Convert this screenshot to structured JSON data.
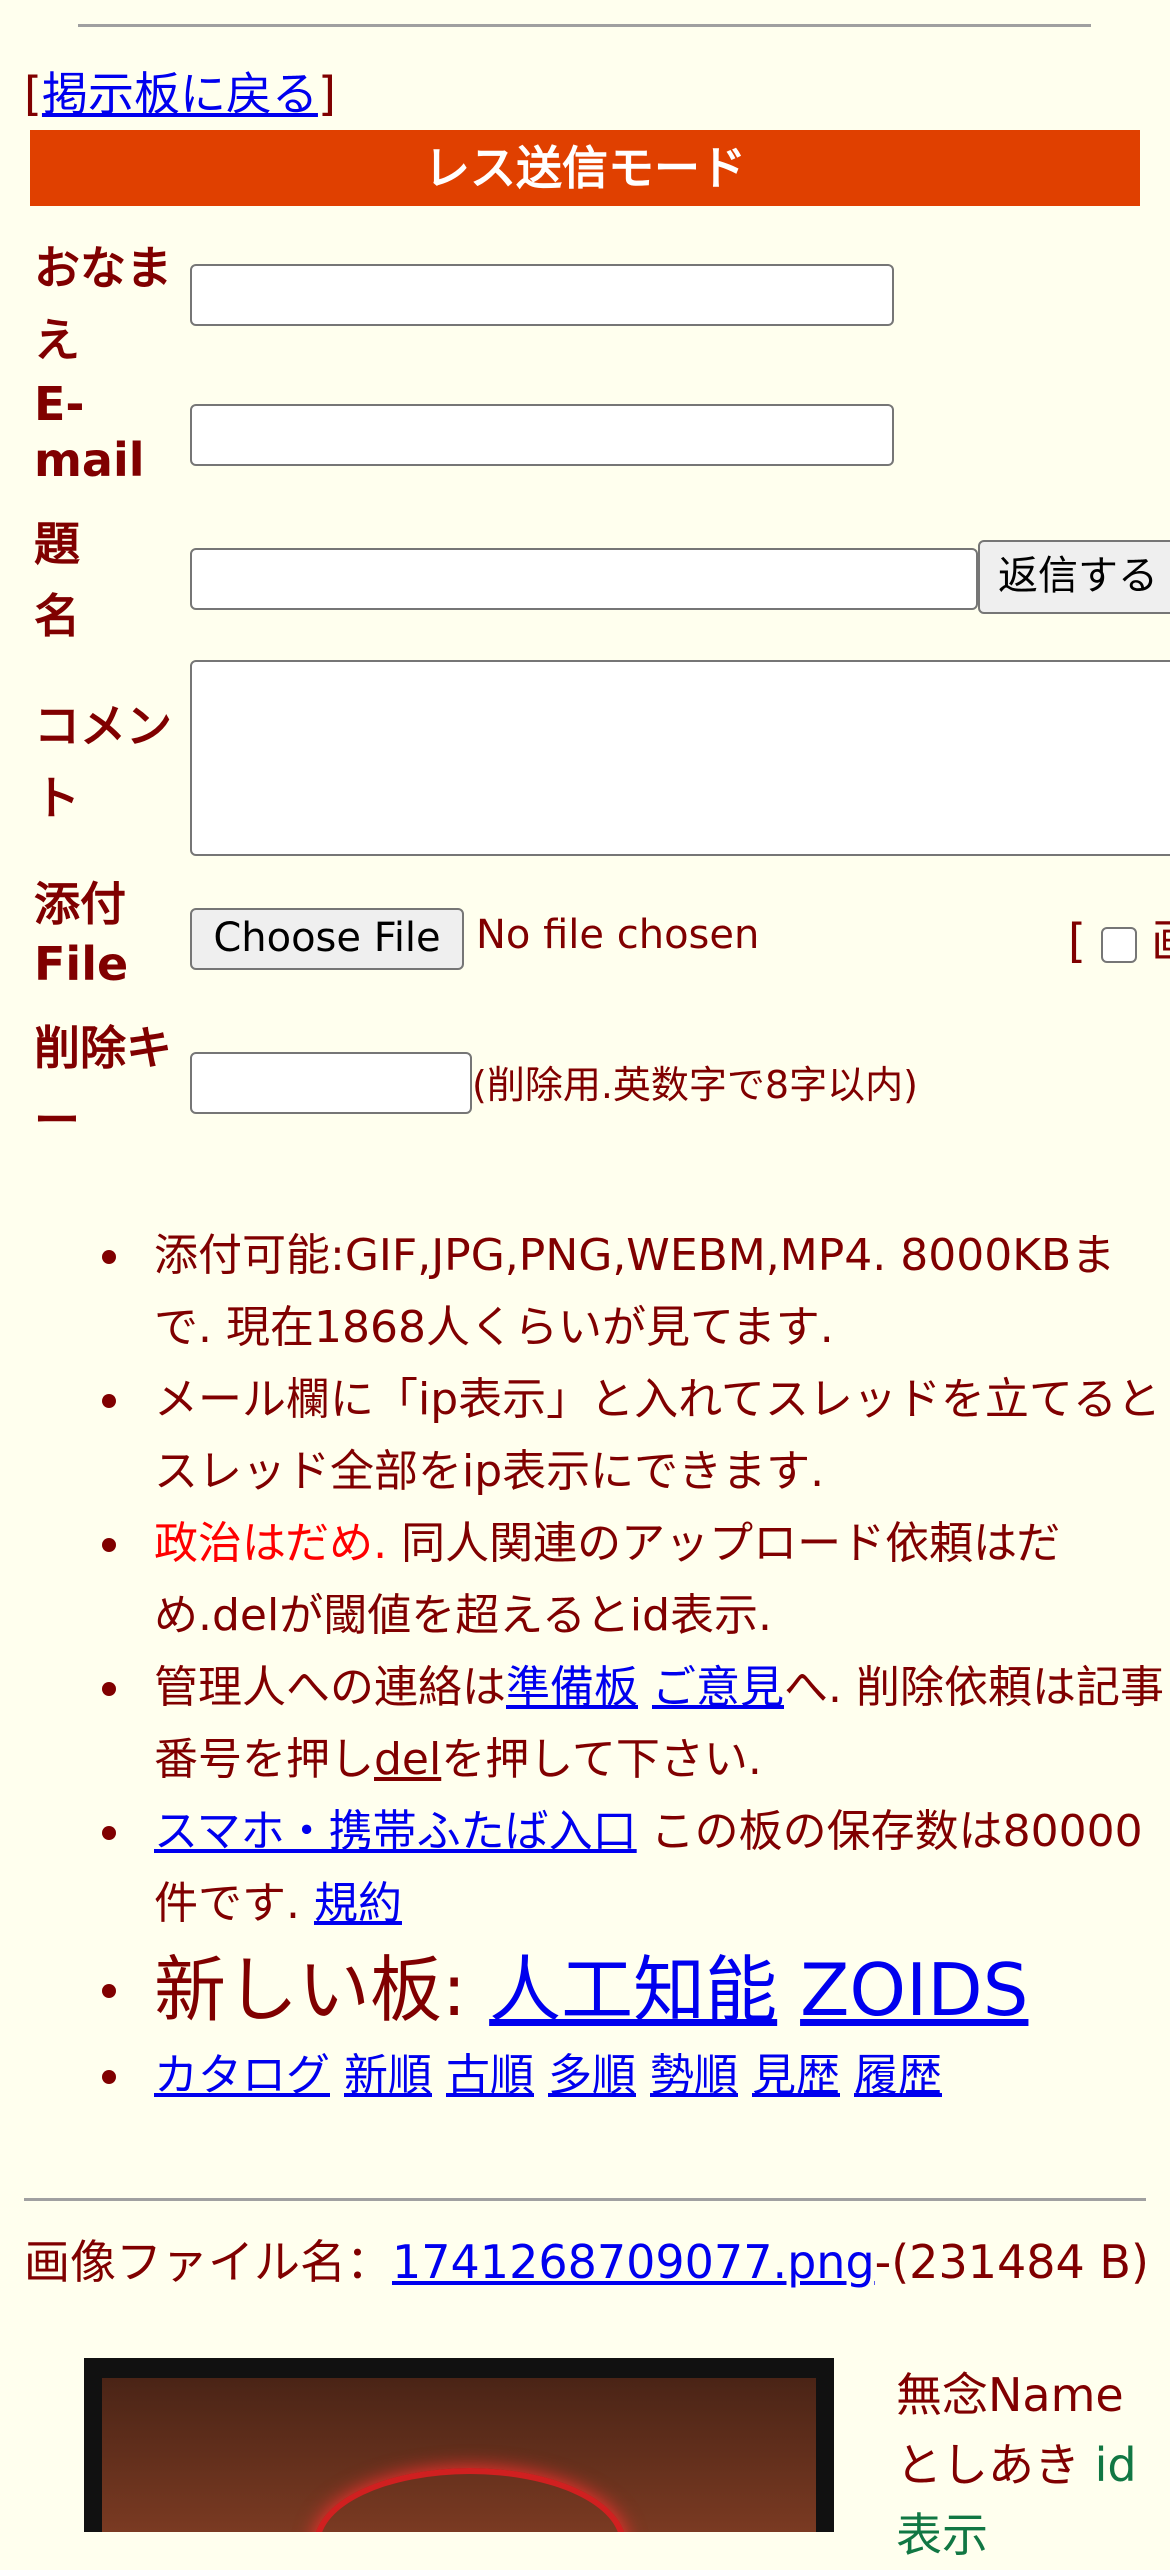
{
  "nav": {
    "back_open": "[",
    "back_link": "掲示板に戻る",
    "back_close": "]"
  },
  "form": {
    "header": "レス送信モード",
    "name_label": "おなまえ",
    "email_label": "E-mail",
    "subject_label": "題名",
    "submit_label": "返信する",
    "comment_label": "コメント",
    "attach_label": "添付File",
    "choose_file_label": "Choose File",
    "no_file_text": "No file chosen",
    "image_option_open": "[",
    "image_option_label": "画",
    "delkey_label": "削除キー",
    "delkey_note": "(削除用.英数字で8字以内)"
  },
  "info": {
    "item1": "添付可能:GIF,JPG,PNG,WEBM,MP4. 8000KBまで. 現在1868人くらいが見てます.",
    "item2": "メール欄に「ip表示」と入れてスレッドを立てるとスレッド全部をip表示にできます.",
    "item3_red": "政治はだめ.",
    "item3_rest": " 同人関連のアップロード依頼はだめ.delが閾値を超えるとid表示.",
    "item4_a": "管理人への連絡は",
    "item4_link1": "準備板",
    "item4_space": " ",
    "item4_link2": "ご意見",
    "item4_b": "へ. 削除依頼は記事番号を押し",
    "item4_link3": "del",
    "item4_c": "を押して下さい.",
    "item5_link": "スマホ・携帯ふたば入口",
    "item5_text": " この板の保存数は80000件です. ",
    "item5_link2": "規約",
    "newboards_label": "新しい板: ",
    "newboard1": "人工知能",
    "newboard2": "ZOIDS",
    "sort_links": [
      "カタログ",
      "新順",
      "古順",
      "多順",
      "勢順",
      "見歴",
      "履歴"
    ]
  },
  "post": {
    "file_label": "画像ファイル名：",
    "file_name": "1741268709077.png",
    "file_size": "-(231484 B)",
    "name": "無念Name",
    "poster": "としあき",
    "id_label": "id",
    "id_label2": "表示"
  }
}
